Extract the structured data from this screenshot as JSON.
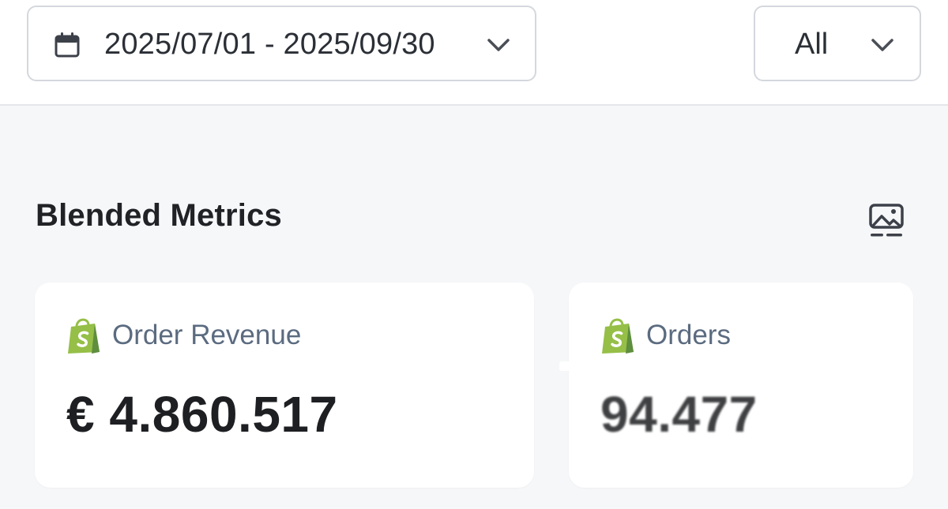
{
  "filters": {
    "date_range": "2025/07/01 - 2025/09/30",
    "segment": "All"
  },
  "section": {
    "title": "Blended Metrics"
  },
  "cards": [
    {
      "label": "Order Revenue",
      "value": "€ 4.860.517",
      "icon": "shopify-icon"
    },
    {
      "label": "Orders",
      "value": "94.477",
      "icon": "shopify-icon"
    }
  ],
  "colors": {
    "shopify_green": "#95bf47",
    "shopify_dark_green": "#5e8e3e",
    "label_gray": "#5b6b80",
    "border": "#d4d8dd",
    "page_bg": "#f6f7f9"
  }
}
